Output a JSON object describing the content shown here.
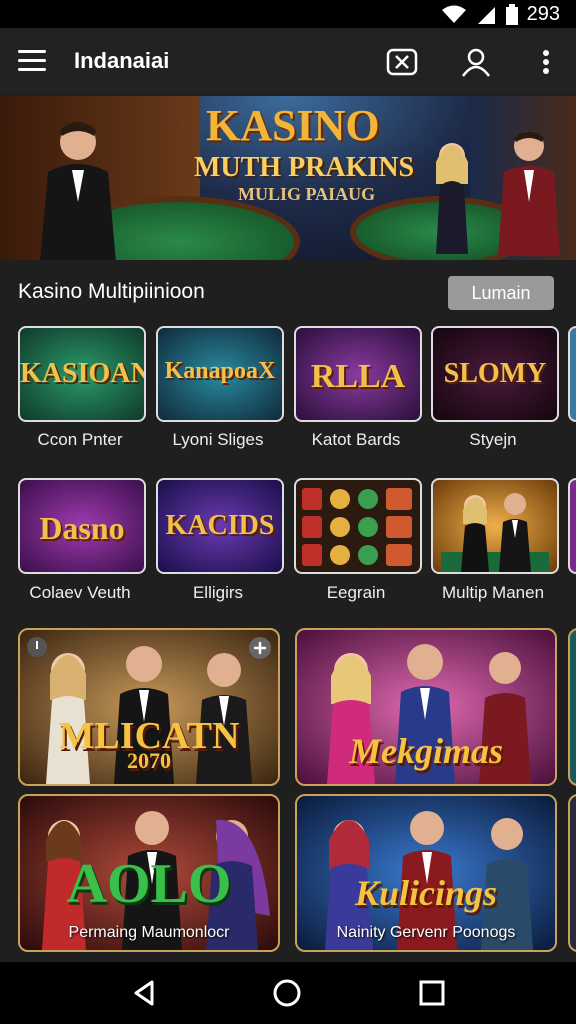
{
  "status": {
    "battery": "293"
  },
  "appbar": {
    "title": "Indanaiai"
  },
  "hero": {
    "line1": "KASINO",
    "line2": "MUTH PRAKINS",
    "line3": "MULIG PAIAUG"
  },
  "section": {
    "title": "Kasino Multipiinioon",
    "action": "Lumain"
  },
  "row1": [
    {
      "word": "KASIOAN",
      "label": "Ccon Pnter",
      "color": "#1f7a55"
    },
    {
      "word": "KanapoaX",
      "label": "Lyoni Sliges",
      "color": "#1a5a70"
    },
    {
      "word": "RLLA",
      "label": "Katot Bards",
      "color": "#5a1f7a"
    },
    {
      "word": "SLOMY",
      "label": "Styejn",
      "color": "#3a0f2a"
    }
  ],
  "row2": [
    {
      "word": "Dasno",
      "label": "Colaev Veuth",
      "color": "#6a1f8a"
    },
    {
      "word": "KACIDS",
      "label": "Elligirs",
      "color": "#3a1a6a"
    },
    {
      "word": "",
      "label": "Eegrain",
      "color": "#2a1a10"
    },
    {
      "word": "",
      "label": "Multip Manen",
      "color": "#a86a1a"
    }
  ],
  "cards": [
    {
      "word": "MLICATN",
      "sub": "2070",
      "caption": "",
      "color": "#7a5a2a"
    },
    {
      "word": "Mekgimas",
      "sub": "",
      "caption": "",
      "color": "#8a2a6a"
    },
    {
      "word": "AOLO",
      "sub": "",
      "caption": "Permaing Maumonlocr",
      "color": "#7a1a1a"
    },
    {
      "word": "Kulicings",
      "sub": "",
      "caption": "Nainity Gervenr Poonogs",
      "color": "#1a3a7a"
    }
  ]
}
